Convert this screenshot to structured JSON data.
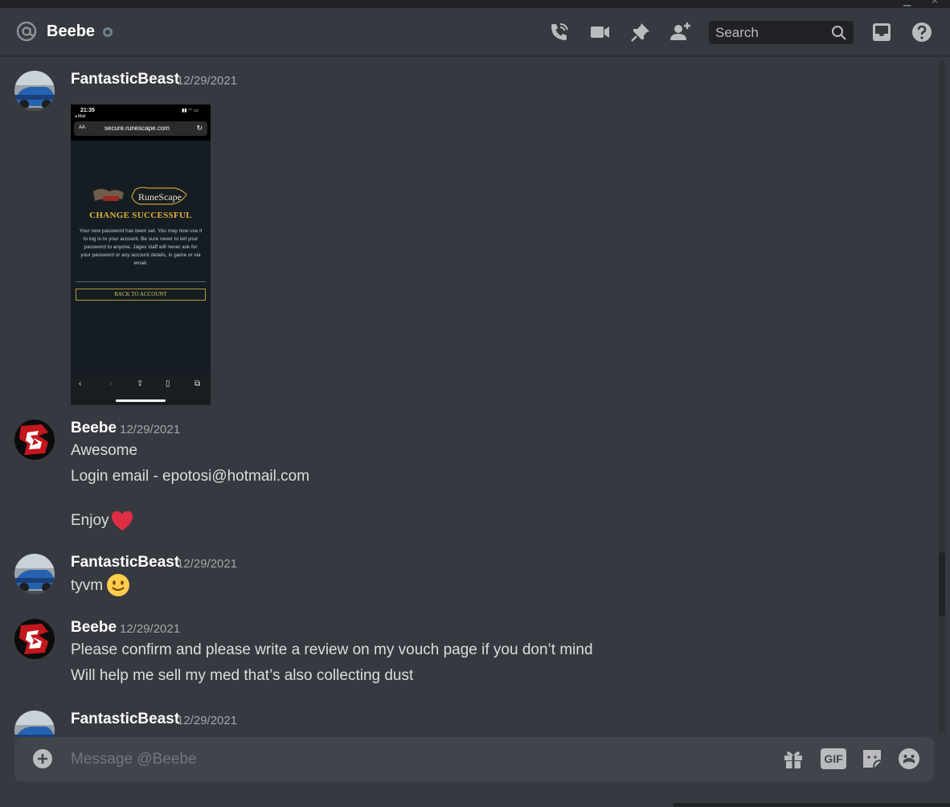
{
  "header": {
    "channel_name": "Beebe",
    "icons": [
      "at-icon",
      "status-offline-icon",
      "voice-call-icon",
      "video-call-icon",
      "pin-icon",
      "add-friend-icon",
      "inbox-icon",
      "help-icon"
    ],
    "search": {
      "placeholder": "Search"
    }
  },
  "messages": [
    {
      "author": "FantasticBeast",
      "timestamp": "12/29/2021",
      "attachment": {
        "clock": "21:35",
        "back_label": "◂ Mail",
        "aa": "AA",
        "url": "secure.runescape.com",
        "title": "CHANGE SUCCESSFUL",
        "body": "Your new password has been set. You may now use it to log in to your account. Be sure never to tell your password to anyone. Jagex staff will never ask for your password or any account details, in game or via email.",
        "button": "BACK TO ACCOUNT"
      }
    },
    {
      "author": "Beebe",
      "timestamp": "12/29/2021",
      "lines": [
        "Awesome",
        "Login email - epotosi@hotmail.com",
        "Enjoy"
      ]
    },
    {
      "author": "FantasticBeast",
      "timestamp": "12/29/2021",
      "lines": [
        "tyvm"
      ]
    },
    {
      "author": "Beebe",
      "timestamp": "12/29/2021",
      "lines": [
        "Please confirm and please write a review on my vouch page if you don’t mind",
        "Will help me sell my med that’s also collecting dust"
      ]
    },
    {
      "author": "FantasticBeast",
      "timestamp": "12/29/2021",
      "lines": []
    }
  ],
  "composer": {
    "placeholder": "Message @Beebe",
    "gif_label": "GIF"
  },
  "colors": {
    "background": "#36393f",
    "header_bg": "#36393f",
    "composer_bg": "#40444b",
    "username": "#ffffff",
    "timestamp": "#a3a6aa",
    "heart": "#dd2e44",
    "emoji": "#ffcc4d"
  }
}
